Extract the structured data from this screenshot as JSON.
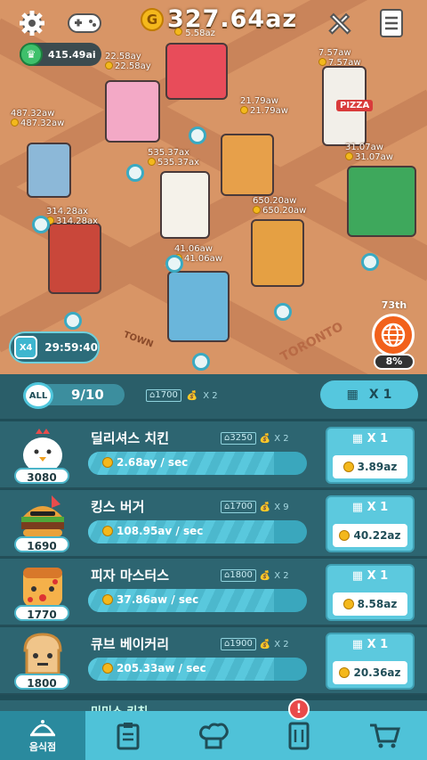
{
  "top": {
    "cash": "327.64az",
    "cash_per_sec": "5.58az",
    "gems": "415.49ai"
  },
  "map": {
    "labels": [
      {
        "small": "22.58ay",
        "big": "22.58ay"
      },
      {
        "small": "7.57aw",
        "big": "7.57aw"
      },
      {
        "small": "487.32aw",
        "big": "487.32aw"
      },
      {
        "small": "21.79aw",
        "big": "21.79aw"
      },
      {
        "small": "535.37ax",
        "big": "535.37ax"
      },
      {
        "small": "31.07aw",
        "big": "31.07aw"
      },
      {
        "small": "314.28ax",
        "big": "314.28ax"
      },
      {
        "small": "650.20aw",
        "big": "650.20aw"
      },
      {
        "small": "41.06aw",
        "big": "41.06aw"
      }
    ],
    "signs": {
      "town": "TOWN",
      "city": "TORONTO",
      "pizza": "PIZZA"
    },
    "ad_badge": "X4",
    "ad_timer": "29:59:40",
    "rank": "73th",
    "rank_percent": "8%"
  },
  "summary": {
    "all_label": "ALL",
    "count": "9/10",
    "cost": "1700",
    "mult": "X 2",
    "buy_label": "X 1"
  },
  "restaurants": [
    {
      "name": "딜리셔스 치킨",
      "level": "3080",
      "cost": "3250",
      "mult": "X 2",
      "rate": "2.68ay / sec",
      "progress": 0.85,
      "buy": "X 1",
      "price": "3.89az"
    },
    {
      "name": "킹스 버거",
      "level": "1690",
      "cost": "1700",
      "mult": "X 9",
      "rate": "108.95av / sec",
      "progress": 0.85,
      "buy": "X 1",
      "price": "40.22az"
    },
    {
      "name": "피자 마스터스",
      "level": "1770",
      "cost": "1800",
      "mult": "X 2",
      "rate": "37.86aw / sec",
      "progress": 0.85,
      "buy": "X 1",
      "price": "8.58az"
    },
    {
      "name": "큐브 베이커리",
      "level": "1800",
      "cost": "1900",
      "mult": "X 2",
      "rate": "205.33aw / sec",
      "progress": 0.85,
      "buy": "X 1",
      "price": "20.36az"
    }
  ],
  "partial_row_name": "미미스 키친",
  "nav": [
    {
      "label": "음식점",
      "icon": "restaurant-icon"
    },
    {
      "label": "",
      "icon": "clipboard-icon"
    },
    {
      "label": "",
      "icon": "chef-hat-icon"
    },
    {
      "label": "",
      "icon": "menu-book-icon"
    },
    {
      "label": "",
      "icon": "cart-icon"
    }
  ],
  "alert": "!"
}
